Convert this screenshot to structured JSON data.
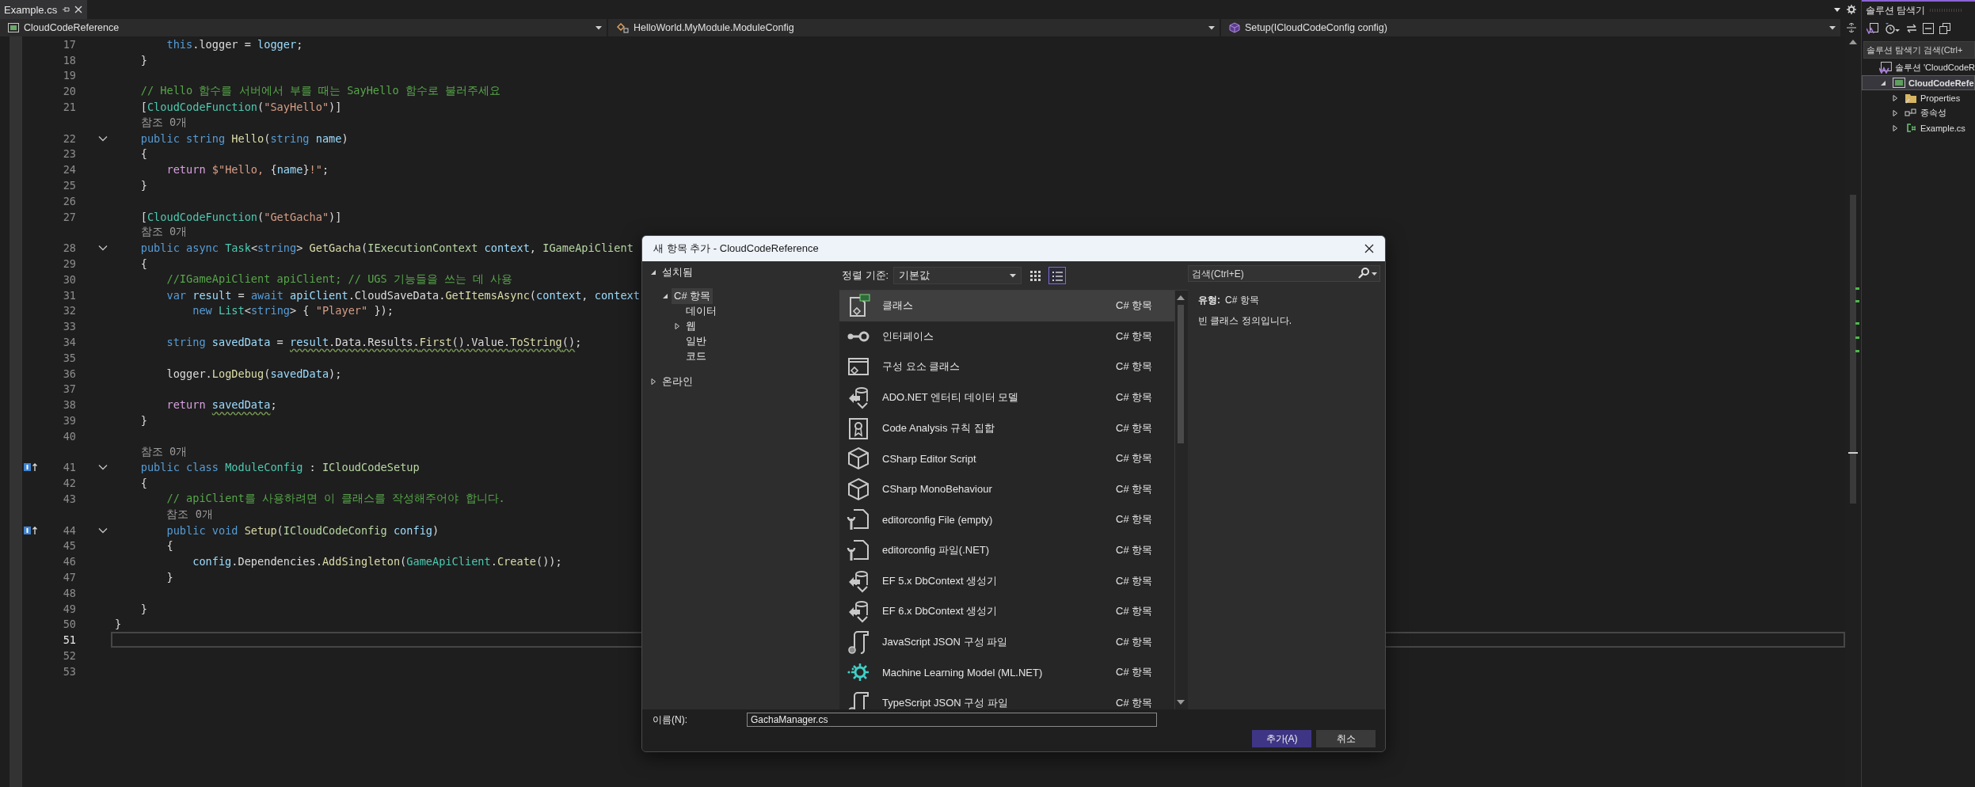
{
  "tabs": [
    {
      "label": "Example.cs",
      "selected": true
    }
  ],
  "nav_bar": {
    "project": "CloudCodeReference",
    "type": "HelloWorld.MyModule.ModuleConfig",
    "member": "Setup(ICloudCodeConfig config)"
  },
  "editor": {
    "lines": [
      {
        "kind": "code",
        "number": "17",
        "tokens": [
          {
            "kind": "keyword",
            "text": "        this"
          },
          {
            "kind": "plain",
            "text": ".logger = "
          },
          {
            "kind": "variable",
            "text": "logger"
          },
          {
            "kind": "plain",
            "text": ";"
          }
        ]
      },
      {
        "kind": "code",
        "number": "18",
        "tokens": [
          {
            "kind": "plain",
            "text": "    }"
          }
        ]
      },
      {
        "kind": "code",
        "number": "19"
      },
      {
        "kind": "code",
        "number": "20",
        "tokens": [
          {
            "kind": "comment",
            "text": "    // Hello 함수를 서버에서 부를 때는 SayHello 함수로 불러주세요"
          }
        ]
      },
      {
        "kind": "code",
        "number": "21",
        "tokens": [
          {
            "kind": "plain",
            "text": "    ["
          },
          {
            "kind": "type",
            "text": "CloudCodeFunction"
          },
          {
            "kind": "plain",
            "text": "("
          },
          {
            "kind": "string",
            "text": "\"SayHello\""
          },
          {
            "kind": "plain",
            "text": ")]"
          }
        ]
      },
      {
        "kind": "lens",
        "text": "    참조 0개"
      },
      {
        "kind": "code",
        "number": "22",
        "fold": true,
        "tokens": [
          {
            "kind": "keyword",
            "text": "    public string "
          },
          {
            "kind": "method",
            "text": "Hello"
          },
          {
            "kind": "plain",
            "text": "("
          },
          {
            "kind": "keyword",
            "text": "string "
          },
          {
            "kind": "variable",
            "text": "name"
          },
          {
            "kind": "plain",
            "text": ")"
          }
        ]
      },
      {
        "kind": "code",
        "number": "23",
        "tokens": [
          {
            "kind": "plain",
            "text": "    {"
          }
        ]
      },
      {
        "kind": "code",
        "number": "24",
        "tokens": [
          {
            "kind": "control",
            "text": "        return "
          },
          {
            "kind": "string",
            "text": "$\"Hello, "
          },
          {
            "kind": "plain",
            "text": "{"
          },
          {
            "kind": "variable",
            "text": "name"
          },
          {
            "kind": "plain",
            "text": "}"
          },
          {
            "kind": "string",
            "text": "!\""
          },
          {
            "kind": "plain",
            "text": ";"
          }
        ]
      },
      {
        "kind": "code",
        "number": "25",
        "tokens": [
          {
            "kind": "plain",
            "text": "    }"
          }
        ]
      },
      {
        "kind": "code",
        "number": "26"
      },
      {
        "kind": "code",
        "number": "27",
        "tokens": [
          {
            "kind": "plain",
            "text": "    ["
          },
          {
            "kind": "type",
            "text": "CloudCodeFunction"
          },
          {
            "kind": "plain",
            "text": "("
          },
          {
            "kind": "string",
            "text": "\"GetGacha\""
          },
          {
            "kind": "plain",
            "text": ")]"
          }
        ]
      },
      {
        "kind": "lens",
        "text": "    참조 0개"
      },
      {
        "kind": "code",
        "number": "28",
        "fold": true,
        "tokens": [
          {
            "kind": "keyword",
            "text": "    public async "
          },
          {
            "kind": "type",
            "text": "Task"
          },
          {
            "kind": "plain",
            "text": "<"
          },
          {
            "kind": "keyword",
            "text": "string"
          },
          {
            "kind": "plain",
            "text": "> "
          },
          {
            "kind": "method",
            "text": "GetGacha"
          },
          {
            "kind": "plain",
            "text": "("
          },
          {
            "kind": "interface",
            "text": "IExecutionContext "
          },
          {
            "kind": "variable",
            "text": "context"
          },
          {
            "kind": "plain",
            "text": ", "
          },
          {
            "kind": "interface",
            "text": "IGameApiClient"
          }
        ]
      },
      {
        "kind": "code",
        "number": "29",
        "tokens": [
          {
            "kind": "plain",
            "text": "    {"
          }
        ]
      },
      {
        "kind": "code",
        "number": "30",
        "tokens": [
          {
            "kind": "comment",
            "text": "        //IGameApiClient apiClient; // UGS 기능들을 쓰는 데 사용"
          }
        ]
      },
      {
        "kind": "code",
        "number": "31",
        "tokens": [
          {
            "kind": "keyword",
            "text": "        var "
          },
          {
            "kind": "variable",
            "text": "result"
          },
          {
            "kind": "plain",
            "text": " = "
          },
          {
            "kind": "keyword",
            "text": "await "
          },
          {
            "kind": "variable",
            "text": "apiClient"
          },
          {
            "kind": "plain",
            "text": ".CloudSaveData."
          },
          {
            "kind": "method",
            "text": "GetItemsAsync"
          },
          {
            "kind": "plain",
            "text": "("
          },
          {
            "kind": "variable",
            "text": "context"
          },
          {
            "kind": "plain",
            "text": ", "
          },
          {
            "kind": "variable",
            "text": "context"
          }
        ]
      },
      {
        "kind": "code",
        "number": "32",
        "tokens": [
          {
            "kind": "keyword",
            "text": "            new "
          },
          {
            "kind": "type",
            "text": "List"
          },
          {
            "kind": "plain",
            "text": "<"
          },
          {
            "kind": "keyword",
            "text": "string"
          },
          {
            "kind": "plain",
            "text": "> { "
          },
          {
            "kind": "string",
            "text": "\"Player\""
          },
          {
            "kind": "plain",
            "text": " });"
          }
        ]
      },
      {
        "kind": "code",
        "number": "33"
      },
      {
        "kind": "code",
        "number": "34",
        "tokens": [
          {
            "kind": "keyword",
            "text": "        string "
          },
          {
            "kind": "variable",
            "text": "savedData"
          },
          {
            "kind": "plain",
            "text": " = "
          },
          {
            "kind": "variable",
            "text": "result",
            "squiggle": true
          },
          {
            "kind": "plain",
            "text": ".Data.Results.",
            "squiggle": true
          },
          {
            "kind": "method",
            "text": "First",
            "squiggle": true
          },
          {
            "kind": "plain",
            "text": "().Value.",
            "squiggle": true
          },
          {
            "kind": "method",
            "text": "ToString",
            "squiggle": true
          },
          {
            "kind": "plain",
            "text": "()",
            "squiggle": true
          },
          {
            "kind": "plain",
            "text": ";"
          }
        ]
      },
      {
        "kind": "code",
        "number": "35"
      },
      {
        "kind": "code",
        "number": "36",
        "tokens": [
          {
            "kind": "plain",
            "text": "        logger."
          },
          {
            "kind": "method",
            "text": "LogDebug"
          },
          {
            "kind": "plain",
            "text": "("
          },
          {
            "kind": "variable",
            "text": "savedData"
          },
          {
            "kind": "plain",
            "text": ");"
          }
        ]
      },
      {
        "kind": "code",
        "number": "37"
      },
      {
        "kind": "code",
        "number": "38",
        "tokens": [
          {
            "kind": "control",
            "text": "        return "
          },
          {
            "kind": "variable",
            "text": "savedData",
            "squiggle": true
          },
          {
            "kind": "plain",
            "text": ";"
          }
        ]
      },
      {
        "kind": "code",
        "number": "39",
        "tokens": [
          {
            "kind": "plain",
            "text": "    }"
          }
        ]
      },
      {
        "kind": "code",
        "number": "40"
      },
      {
        "kind": "lens",
        "text": "    참조 0개"
      },
      {
        "kind": "code",
        "number": "41",
        "fold": true,
        "implements": true,
        "tokens": [
          {
            "kind": "keyword",
            "text": "    public class "
          },
          {
            "kind": "type",
            "text": "ModuleConfig"
          },
          {
            "kind": "plain",
            "text": " : "
          },
          {
            "kind": "interface",
            "text": "ICloudCodeSetup"
          }
        ]
      },
      {
        "kind": "code",
        "number": "42",
        "tokens": [
          {
            "kind": "plain",
            "text": "    {"
          }
        ]
      },
      {
        "kind": "code",
        "number": "43",
        "tokens": [
          {
            "kind": "comment",
            "text": "        // apiClient를 사용하려면 이 클래스를 작성해주어야 합니다."
          }
        ]
      },
      {
        "kind": "lens",
        "text": "        참조 0개"
      },
      {
        "kind": "code",
        "number": "44",
        "fold": true,
        "implements": true,
        "tokens": [
          {
            "kind": "keyword",
            "text": "        public void "
          },
          {
            "kind": "method",
            "text": "Setup"
          },
          {
            "kind": "plain",
            "text": "("
          },
          {
            "kind": "interface",
            "text": "ICloudCodeConfig "
          },
          {
            "kind": "variable",
            "text": "config"
          },
          {
            "kind": "plain",
            "text": ")"
          }
        ]
      },
      {
        "kind": "code",
        "number": "45",
        "tokens": [
          {
            "kind": "plain",
            "text": "        {"
          }
        ]
      },
      {
        "kind": "code",
        "number": "46",
        "tokens": [
          {
            "kind": "variable",
            "text": "            config"
          },
          {
            "kind": "plain",
            "text": ".Dependencies."
          },
          {
            "kind": "method",
            "text": "AddSingleton"
          },
          {
            "kind": "plain",
            "text": "("
          },
          {
            "kind": "type",
            "text": "GameApiClient"
          },
          {
            "kind": "plain",
            "text": "."
          },
          {
            "kind": "method",
            "text": "Create"
          },
          {
            "kind": "plain",
            "text": "());"
          }
        ]
      },
      {
        "kind": "code",
        "number": "47",
        "tokens": [
          {
            "kind": "plain",
            "text": "        }"
          }
        ]
      },
      {
        "kind": "code",
        "number": "48"
      },
      {
        "kind": "code",
        "number": "49",
        "tokens": [
          {
            "kind": "plain",
            "text": "    }"
          }
        ]
      },
      {
        "kind": "code",
        "number": "50",
        "tokens": [
          {
            "kind": "plain",
            "text": "}"
          }
        ]
      },
      {
        "kind": "code",
        "number": "51",
        "current": true
      },
      {
        "kind": "code",
        "number": "52"
      },
      {
        "kind": "code",
        "number": "53"
      }
    ]
  },
  "solution_explorer": {
    "title": "솔루션 탐색기",
    "search": {
      "placeholder": "솔루션 탐색기 검색(Ctrl+"
    },
    "tree": [
      {
        "label": "솔루션 'CloudCodeR",
        "kind": "solution",
        "selected": false,
        "children": [
          {
            "label": "CloudCodeRefe",
            "kind": "project",
            "expanded": true,
            "selected": true,
            "children": [
              {
                "label": "Properties",
                "kind": "properties",
                "expanded": false,
                "selected": false
              },
              {
                "label": "종속성",
                "kind": "dependencies",
                "expanded": false,
                "selected": false
              },
              {
                "label": "Example.cs",
                "kind": "csharp",
                "expanded": false,
                "selected": false
              }
            ]
          }
        ]
      }
    ]
  },
  "dialog": {
    "title": "새 항목 추가 - CloudCodeReference",
    "tree": [
      {
        "label": "설치됨",
        "expanded": true,
        "selected": false,
        "children": [
          {
            "label": "C# 항목",
            "expanded": true,
            "selected": true,
            "children": [
              {
                "label": "데이터",
                "selected": false
              },
              {
                "label": "웹",
                "expanded": false,
                "selected": false
              },
              {
                "label": "일반",
                "selected": false
              },
              {
                "label": "코드",
                "selected": false
              }
            ]
          }
        ]
      },
      {
        "label": "온라인",
        "expanded": false,
        "selected": false
      }
    ],
    "sort": {
      "label": "정렬 기준:",
      "value": "기본값"
    },
    "views": [
      {
        "kind": "grid",
        "selected": false
      },
      {
        "kind": "list",
        "selected": true
      }
    ],
    "templates": [
      {
        "name": "클래스",
        "category": "C# 항목",
        "kind": "class",
        "selected": true
      },
      {
        "name": "인터페이스",
        "category": "C# 항목",
        "kind": "interface",
        "selected": false
      },
      {
        "name": "구성 요소 클래스",
        "category": "C# 항목",
        "kind": "component",
        "selected": false
      },
      {
        "name": "ADO.NET 엔터티 데이터 모델",
        "category": "C# 항목",
        "kind": "data-model",
        "selected": false
      },
      {
        "name": "Code Analysis 규칙 집합",
        "category": "C# 항목",
        "kind": "ruleset",
        "selected": false
      },
      {
        "name": "CSharp Editor Script",
        "category": "C# 항목",
        "kind": "script",
        "selected": false
      },
      {
        "name": "CSharp MonoBehaviour",
        "category": "C# 항목",
        "kind": "script",
        "selected": false
      },
      {
        "name": "editorconfig File (empty)",
        "category": "C# 항목",
        "kind": "config",
        "selected": false
      },
      {
        "name": "editorconfig 파일(.NET)",
        "category": "C# 항목",
        "kind": "config",
        "selected": false
      },
      {
        "name": "EF 5.x DbContext 생성기",
        "category": "C# 항목",
        "kind": "data-model",
        "selected": false
      },
      {
        "name": "EF 6.x DbContext 생성기",
        "category": "C# 항목",
        "kind": "data-model",
        "selected": false
      },
      {
        "name": "JavaScript JSON 구성 파일",
        "category": "C# 항목",
        "kind": "json",
        "selected": false
      },
      {
        "name": "Machine Learning Model (ML.NET)",
        "category": "C# 항목",
        "kind": "ml",
        "selected": false
      },
      {
        "name": "TypeScript JSON 구성 파일",
        "category": "C# 항목",
        "kind": "json",
        "selected": false
      }
    ],
    "search": {
      "placeholder": "검색(Ctrl+E)"
    },
    "details": {
      "type_label": "유형:",
      "type": "C# 항목",
      "description": "빈 클래스 정의입니다."
    },
    "name_field": {
      "label": "이름(N):",
      "value": "GachaManager.cs"
    },
    "buttons": [
      {
        "label": "추가(A)",
        "kind": "primary"
      },
      {
        "label": "취소",
        "kind": "secondary"
      }
    ]
  }
}
